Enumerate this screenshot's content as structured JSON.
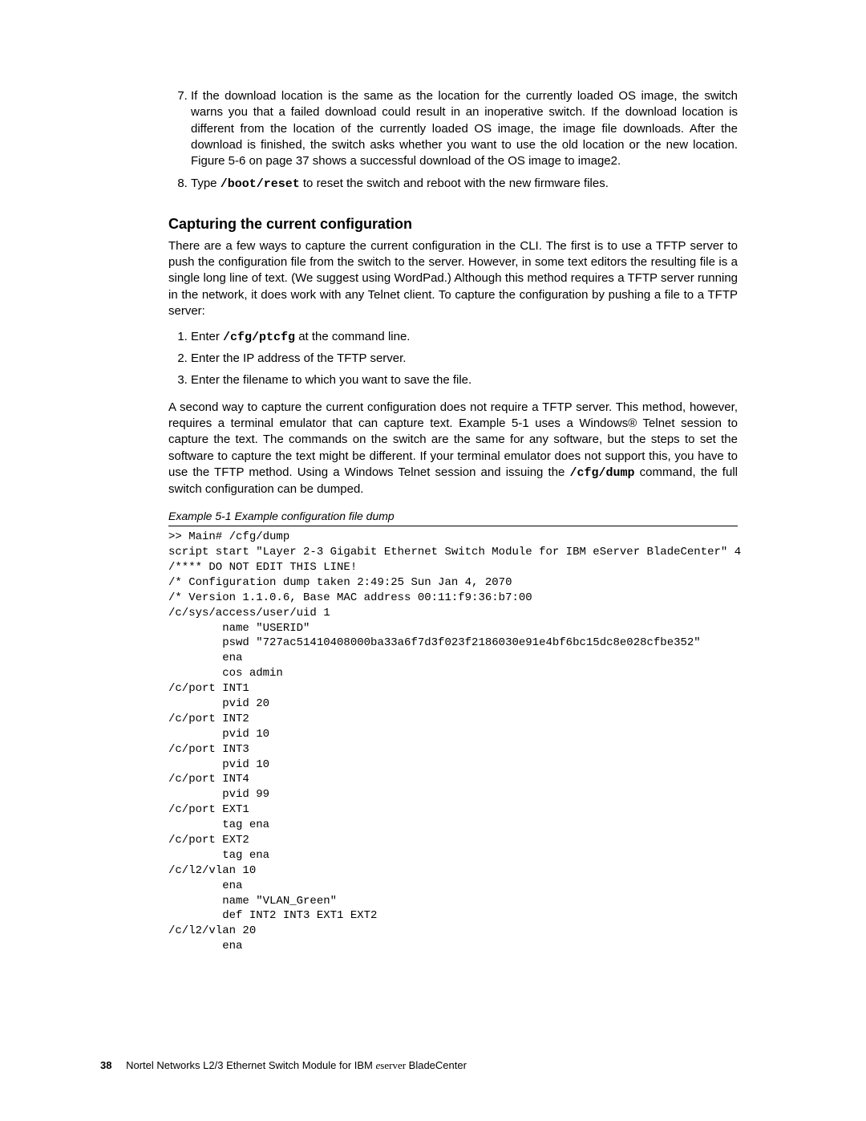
{
  "instructions": {
    "item7": "If the download location is the same as the location for the currently loaded OS image, the switch warns you that a failed download could result in an inoperative switch. If the download location is different from the location of the currently loaded OS image, the image file downloads. After the download is finished, the switch asks whether you want to use the old location or the new location. Figure 5-6 on page 37 shows a successful download of the OS image to image2.",
    "item8_prefix": "Type ",
    "item8_cmd": "/boot/reset",
    "item8_suffix": " to reset the switch and reboot with the new firmware files."
  },
  "section_title": "Capturing the current configuration",
  "intro": "There are a few ways to capture the current configuration in the CLI. The first is to use a TFTP server to push the configuration file from the switch to the server. However, in some text editors the resulting file is a single long line of text. (We suggest using WordPad.) Although this method requires a TFTP server running in the network, it does work with any Telnet client. To capture the configuration by pushing a file to a TFTP server:",
  "steps": {
    "s1_prefix": "Enter ",
    "s1_cmd": "/cfg/ptcfg",
    "s1_suffix": " at the command line.",
    "s2": "Enter the IP address of the TFTP server.",
    "s3": "Enter the filename to which you want to save the file."
  },
  "para2_prefix": "A second way to capture the current configuration does not require a TFTP server. This method, however, requires a terminal emulator that can capture text. Example 5-1 uses a Windows® Telnet session to capture the text. The commands on the switch are the same for any software, but the steps to set the software to capture the text might be different. If your terminal emulator does not support this, you have to use the TFTP method. Using a Windows Telnet session and issuing the ",
  "para2_cmd": "/cfg/dump",
  "para2_suffix": " command, the full switch configuration can be dumped.",
  "example_caption": "Example 5-1   Example configuration file dump",
  "code_dump": ">> Main# /cfg/dump\nscript start \"Layer 2-3 Gigabit Ethernet Switch Module for IBM eServer BladeCenter\" 4\n/**** DO NOT EDIT THIS LINE!\n/* Configuration dump taken 2:49:25 Sun Jan 4, 2070\n/* Version 1.1.0.6, Base MAC address 00:11:f9:36:b7:00\n/c/sys/access/user/uid 1\n        name \"USERID\"\n        pswd \"727ac51410408000ba33a6f7d3f023f2186030e91e4bf6bc15dc8e028cfbe352\"\n        ena\n        cos admin\n/c/port INT1\n        pvid 20\n/c/port INT2\n        pvid 10\n/c/port INT3\n        pvid 10\n/c/port INT4\n        pvid 99\n/c/port EXT1\n        tag ena\n/c/port EXT2\n        tag ena\n/c/l2/vlan 10\n        ena\n        name \"VLAN_Green\"\n        def INT2 INT3 EXT1 EXT2\n/c/l2/vlan 20\n        ena",
  "footer": {
    "page_number": "38",
    "title_prefix": "Nortel Networks L2/3 Ethernet Switch Module for IBM ",
    "eserver_e": "e",
    "eserver_rest": "server",
    "title_suffix": " BladeCenter"
  }
}
